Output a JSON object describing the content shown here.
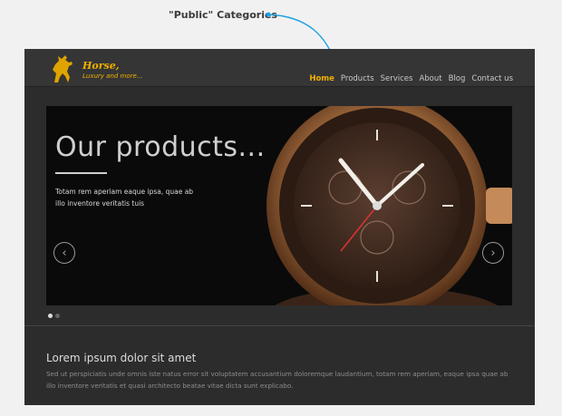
{
  "annotation": {
    "label": "\"Public\" Categories",
    "color": "#1aa0e6"
  },
  "logo": {
    "title": "Horse,",
    "subtitle": "Luxury and more..."
  },
  "nav": {
    "items": [
      "Home",
      "Products",
      "Services",
      "About",
      "Blog",
      "Contact us"
    ],
    "active": "Home"
  },
  "slider": {
    "title": "Our products...",
    "text": "Totam rem aperiam eaque ipsa, quae ab illo inventore veritatis tuis",
    "prev_icon": "‹",
    "next_icon": "›",
    "dots": 2,
    "active_dot": 0
  },
  "section": {
    "title": "Lorem ipsum dolor sit amet",
    "text": "Sed ut perspiciatis unde omnis iste natus error sit voluptatem accusantium doloremque laudantium, totam rem aperiam, eaque ipsa quae ab illo inventore veritatis et quasi architecto beatae vitae dicta sunt explicabo."
  },
  "colors": {
    "accent": "#f0b000",
    "background": "#2c2c2c"
  }
}
